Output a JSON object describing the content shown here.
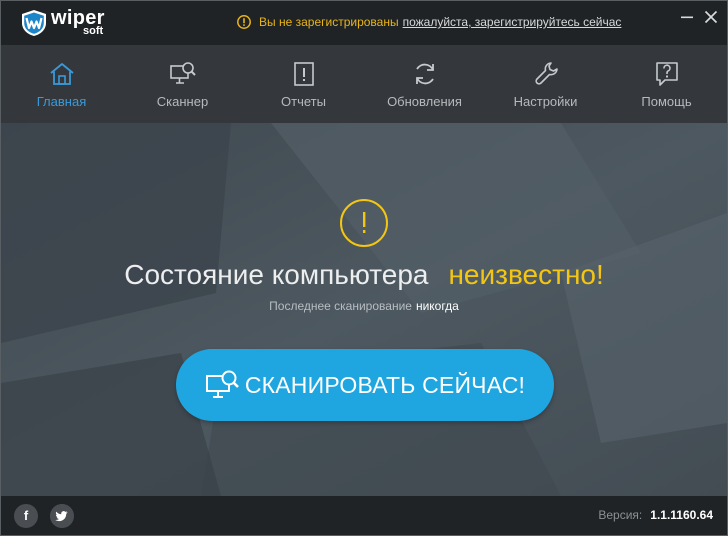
{
  "app": {
    "logo_main": "wiper",
    "logo_sub": "soft"
  },
  "notice": {
    "text": "Вы не зарегистрированы",
    "link": "пожалуйста, зарегистрируйтесь сейчас",
    "color": "#e8b518"
  },
  "nav": {
    "items": [
      {
        "label": "Главная",
        "icon": "home-icon",
        "active": true
      },
      {
        "label": "Сканнер",
        "icon": "scanner-icon"
      },
      {
        "label": "Отчеты",
        "icon": "report-icon"
      },
      {
        "label": "Обновления",
        "icon": "refresh-icon"
      },
      {
        "label": "Настройки",
        "icon": "wrench-icon"
      },
      {
        "label": "Помощь",
        "icon": "help-icon"
      }
    ],
    "active_color": "#3a9ad9"
  },
  "status": {
    "title": "Состояние компьютера",
    "value": "неизвестно!",
    "value_color": "#f3c614",
    "last_scan_label": "Последнее сканирование",
    "last_scan_value": "никогда"
  },
  "scan_button": {
    "label": "СКАНИРОВАТЬ СЕЙЧАС!",
    "color": "#1fa6e0"
  },
  "footer": {
    "facebook": "f",
    "version_label": "Версия:",
    "version_value": "1.1.1160.64"
  }
}
